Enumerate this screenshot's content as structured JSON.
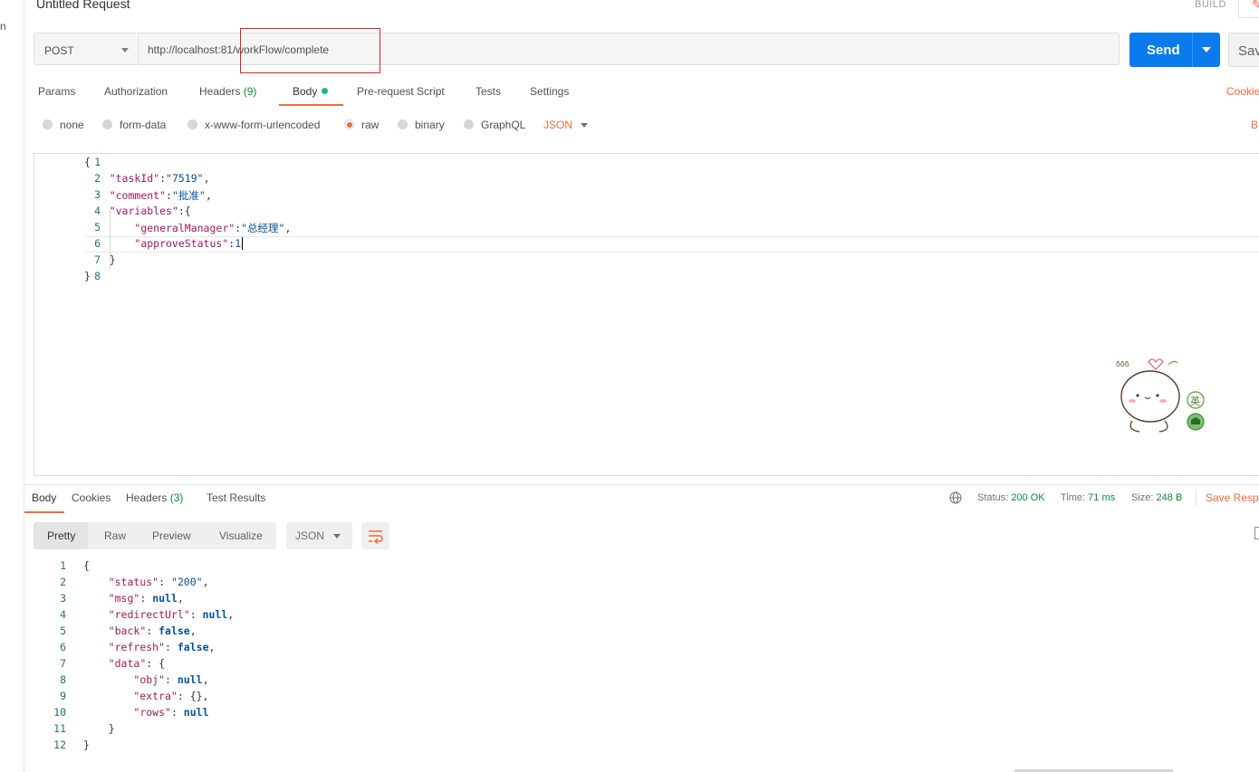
{
  "left_fragment": "n",
  "header": {
    "title": "Untitled Request",
    "build_label": "BUILD"
  },
  "request": {
    "method": "POST",
    "url": "http://localhost:81/workFlow/complete",
    "send_label": "Send",
    "save_label": "Sav"
  },
  "request_tabs": [
    {
      "label": "Params"
    },
    {
      "label": "Authorization"
    },
    {
      "label": "Headers",
      "count": "(9)"
    },
    {
      "label": "Body",
      "active": true
    },
    {
      "label": "Pre-request Script"
    },
    {
      "label": "Tests"
    },
    {
      "label": "Settings"
    }
  ],
  "cookies_link": "Cookie",
  "body_types": [
    {
      "label": "none"
    },
    {
      "label": "form-data"
    },
    {
      "label": "x-www-form-urlencoded"
    },
    {
      "label": "raw",
      "selected": true
    },
    {
      "label": "binary"
    },
    {
      "label": "GraphQL"
    }
  ],
  "raw_format": "JSON",
  "beautify_fragment": "B",
  "request_body_lines": [
    "{",
    "    \"taskId\":\"7519\",",
    "    \"comment\":\"批准\",",
    "    \"variables\":{",
    "        \"generalManager\":\"总经理\",",
    "        \"approveStatus\":1",
    "    }",
    "}"
  ],
  "sticker_text": "英",
  "response_tabs": [
    {
      "label": "Body",
      "active": true
    },
    {
      "label": "Cookies"
    },
    {
      "label": "Headers",
      "count": "(3)"
    },
    {
      "label": "Test Results"
    }
  ],
  "response_meta": {
    "status_label": "Status:",
    "status_value": "200 OK",
    "time_label": "Time:",
    "time_value": "71 ms",
    "size_label": "Size:",
    "size_value": "248 B",
    "save_response": "Save Resp"
  },
  "view_modes": [
    "Pretty",
    "Raw",
    "Preview",
    "Visualize"
  ],
  "response_format": "JSON",
  "response_body_lines": [
    "{",
    "    \"status\": \"200\",",
    "    \"msg\": null,",
    "    \"redirectUrl\": null,",
    "    \"back\": false,",
    "    \"refresh\": false,",
    "    \"data\": {",
    "        \"obj\": null,",
    "        \"extra\": {},",
    "        \"rows\": null",
    "    }",
    "}"
  ],
  "colors": {
    "accent": "#f26b3a",
    "send": "#097bed",
    "status_ok": "#0a8a3a",
    "json_key": "#a2185d",
    "json_value": "#0451a5"
  }
}
